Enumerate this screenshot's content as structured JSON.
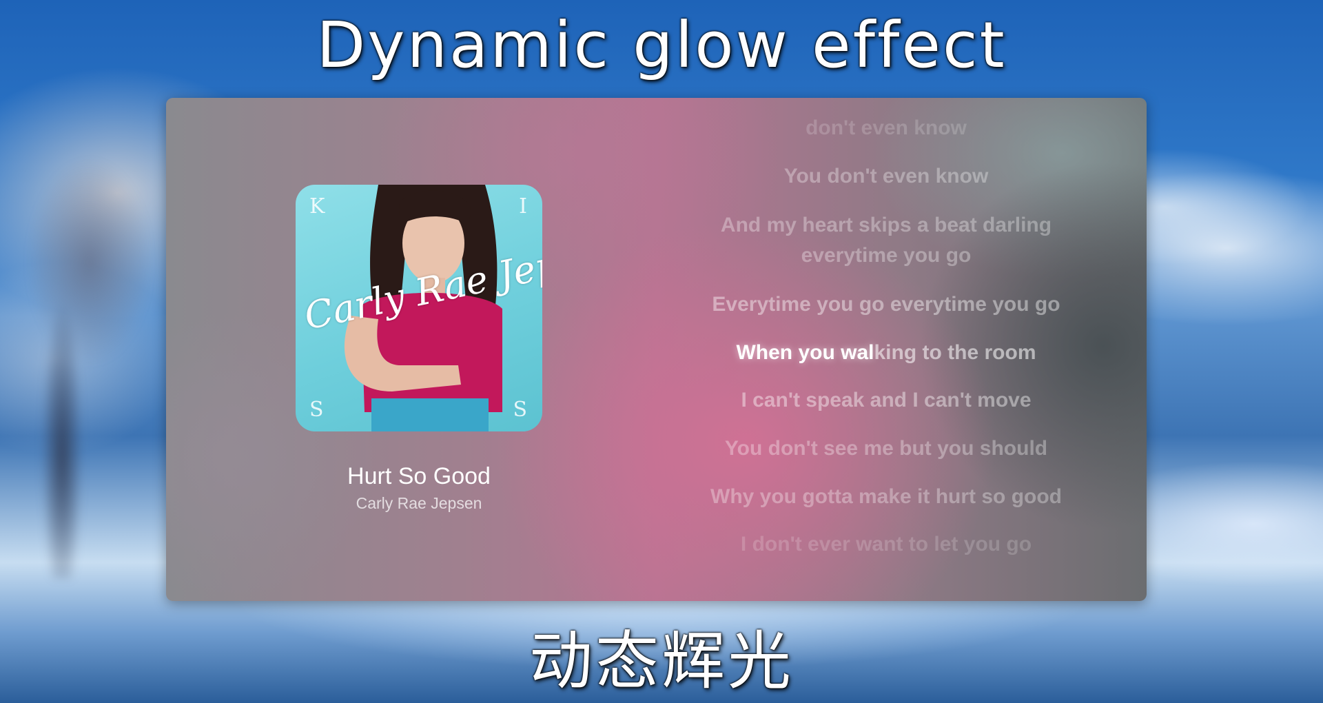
{
  "headline": {
    "top": "Dynamic glow effect",
    "bottom": "动态辉光"
  },
  "track": {
    "title": "Hurt So Good",
    "artist": "Carly Rae Jepsen"
  },
  "cover": {
    "corner_letters": [
      "K",
      "I",
      "S",
      "S"
    ],
    "signature": "Carly Rae Jepsen"
  },
  "lyrics": [
    {
      "text": "don't even know",
      "state": "far"
    },
    {
      "text": "You don't even know",
      "state": "past"
    },
    {
      "text": "And my heart skips a beat  darling",
      "state": "past"
    },
    {
      "text": "everytime you go",
      "state": "past"
    },
    {
      "text": "Everytime you go  everytime you go",
      "state": "near"
    },
    {
      "sung": "When you wal",
      "rest": "king to the room",
      "state": "current"
    },
    {
      "text": "I can't speak  and I can't move",
      "state": "near"
    },
    {
      "text": "You don't see me  but you should",
      "state": "upcoming"
    },
    {
      "text": "Why you gotta make it hurt so good",
      "state": "upcoming"
    },
    {
      "text": "I don't ever want to let you go",
      "state": "far"
    }
  ],
  "colors": {
    "accent_pink": "#d67096",
    "cover_bg": "#6fcfdc",
    "shirt": "#c2185b"
  }
}
